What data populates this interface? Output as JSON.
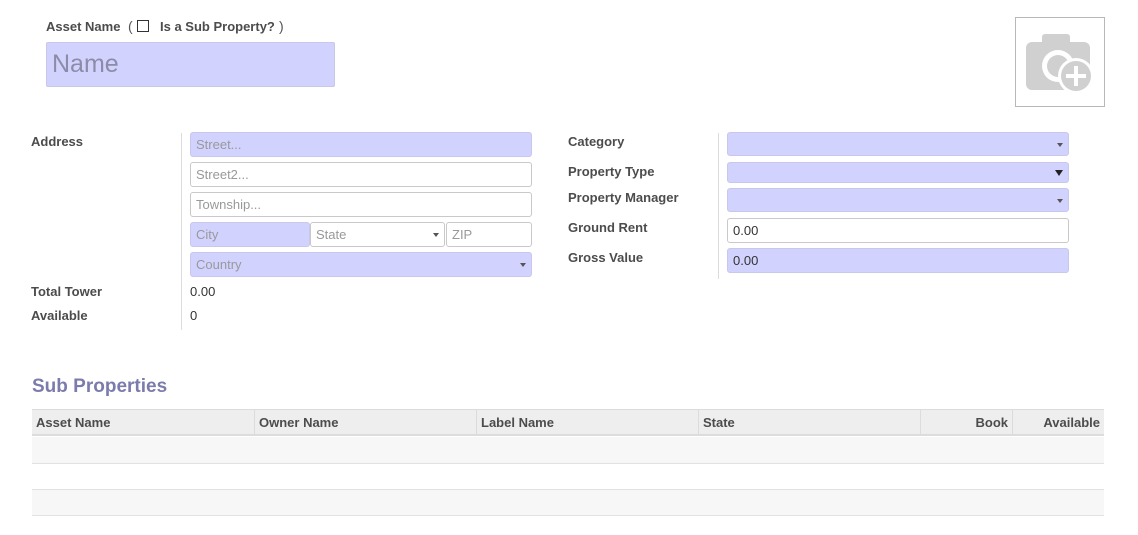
{
  "header": {
    "asset_name_label": "Asset Name",
    "paren_open": "(",
    "paren_close": ")",
    "sub_property_label": "Is a Sub Property?",
    "sub_property_checked": false,
    "name_placeholder": "Name",
    "photo_icon": "camera-plus-icon"
  },
  "address": {
    "label": "Address",
    "street_placeholder": "Street...",
    "street2_placeholder": "Street2...",
    "township_placeholder": "Township...",
    "city_placeholder": "City",
    "state_placeholder": "State",
    "zip_placeholder": "ZIP",
    "country_placeholder": "Country"
  },
  "stats": {
    "total_tower_label": "Total Tower",
    "total_tower_value": "0.00",
    "available_label": "Available",
    "available_value": "0"
  },
  "right_fields": {
    "category_label": "Category",
    "category_value": "",
    "property_type_label": "Property Type",
    "property_type_value": "",
    "property_manager_label": "Property Manager",
    "property_manager_value": "",
    "ground_rent_label": "Ground Rent",
    "ground_rent_value": "0.00",
    "gross_value_label": "Gross Value",
    "gross_value_value": "0.00"
  },
  "sub_properties": {
    "title": "Sub Properties",
    "columns": [
      "Asset Name",
      "Owner Name",
      "Label Name",
      "State",
      "Book",
      "Available"
    ]
  },
  "colors": {
    "required_field": "#d2d2ff",
    "section_title": "#7c7bad",
    "table_header": "#eeeeee"
  }
}
